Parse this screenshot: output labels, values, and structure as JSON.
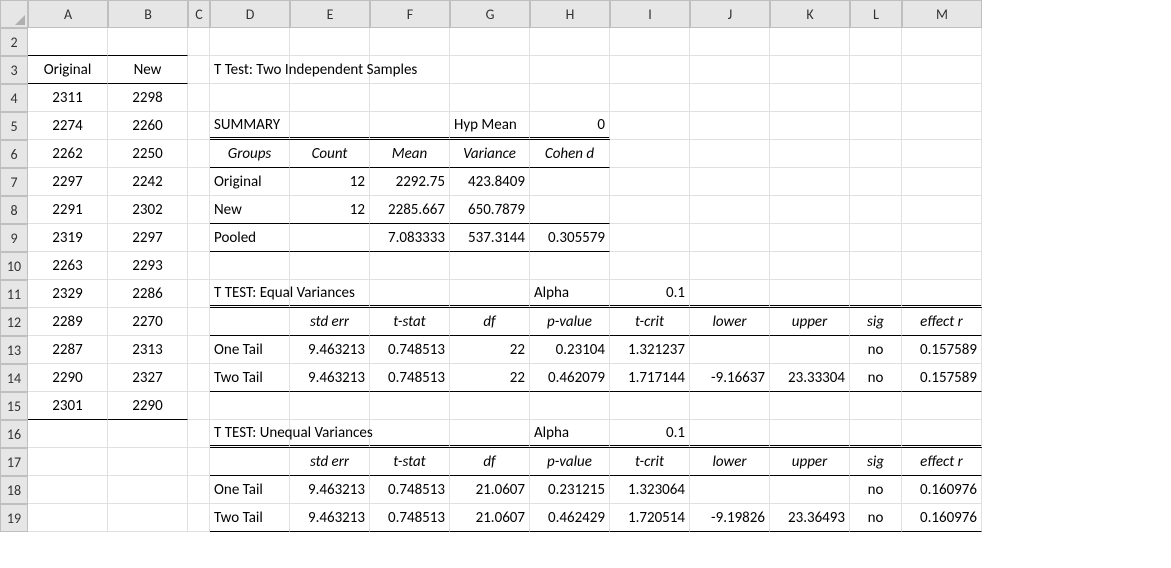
{
  "columns": [
    "A",
    "B",
    "C",
    "D",
    "E",
    "F",
    "G",
    "H",
    "I",
    "J",
    "K",
    "L",
    "M"
  ],
  "rows": [
    "2",
    "3",
    "4",
    "5",
    "6",
    "7",
    "8",
    "9",
    "10",
    "11",
    "12",
    "13",
    "14",
    "15",
    "16",
    "17",
    "18",
    "19"
  ],
  "data_headers": {
    "original": "Original",
    "new": "New"
  },
  "pairs": [
    {
      "a": "2311",
      "b": "2298"
    },
    {
      "a": "2274",
      "b": "2260"
    },
    {
      "a": "2262",
      "b": "2250"
    },
    {
      "a": "2297",
      "b": "2242"
    },
    {
      "a": "2291",
      "b": "2302"
    },
    {
      "a": "2319",
      "b": "2297"
    },
    {
      "a": "2263",
      "b": "2293"
    },
    {
      "a": "2329",
      "b": "2286"
    },
    {
      "a": "2289",
      "b": "2270"
    },
    {
      "a": "2287",
      "b": "2313"
    },
    {
      "a": "2290",
      "b": "2327"
    },
    {
      "a": "2301",
      "b": "2290"
    }
  ],
  "title": "T Test: Two Independent Samples",
  "summary": {
    "label": "SUMMARY",
    "hypmean_label": "Hyp Mean",
    "hypmean_value": "0",
    "cols": {
      "groups": "Groups",
      "count": "Count",
      "mean": "Mean",
      "variance": "Variance",
      "cohend": "Cohen d"
    },
    "rows": {
      "original": {
        "label": "Original",
        "count": "12",
        "mean": "2292.75",
        "variance": "423.8409",
        "cohend": ""
      },
      "new": {
        "label": "New",
        "count": "12",
        "mean": "2285.667",
        "variance": "650.7879",
        "cohend": ""
      },
      "pooled": {
        "label": "Pooled",
        "count": "",
        "mean": "7.083333",
        "variance": "537.3144",
        "cohend": "0.305579"
      }
    }
  },
  "eq": {
    "title": "T TEST: Equal Variances",
    "alpha_label": "Alpha",
    "alpha_value": "0.1",
    "cols": {
      "stderr": "std err",
      "tstat": "t-stat",
      "df": "df",
      "pvalue": "p-value",
      "tcrit": "t-crit",
      "lower": "lower",
      "upper": "upper",
      "sig": "sig",
      "effectr": "effect r"
    },
    "one": {
      "label": "One Tail",
      "stderr": "9.463213",
      "tstat": "0.748513",
      "df": "22",
      "pvalue": "0.23104",
      "tcrit": "1.321237",
      "lower": "",
      "upper": "",
      "sig": "no",
      "effectr": "0.157589"
    },
    "two": {
      "label": "Two Tail",
      "stderr": "9.463213",
      "tstat": "0.748513",
      "df": "22",
      "pvalue": "0.462079",
      "tcrit": "1.717144",
      "lower": "-9.16637",
      "upper": "23.33304",
      "sig": "no",
      "effectr": "0.157589"
    }
  },
  "uneq": {
    "title": "T TEST: Unequal Variances",
    "alpha_label": "Alpha",
    "alpha_value": "0.1",
    "cols": {
      "stderr": "std err",
      "tstat": "t-stat",
      "df": "df",
      "pvalue": "p-value",
      "tcrit": "t-crit",
      "lower": "lower",
      "upper": "upper",
      "sig": "sig",
      "effectr": "effect r"
    },
    "one": {
      "label": "One Tail",
      "stderr": "9.463213",
      "tstat": "0.748513",
      "df": "21.0607",
      "pvalue": "0.231215",
      "tcrit": "1.323064",
      "lower": "",
      "upper": "",
      "sig": "no",
      "effectr": "0.160976"
    },
    "two": {
      "label": "Two Tail",
      "stderr": "9.463213",
      "tstat": "0.748513",
      "df": "21.0607",
      "pvalue": "0.462429",
      "tcrit": "1.720514",
      "lower": "-9.19826",
      "upper": "23.36493",
      "sig": "no",
      "effectr": "0.160976"
    }
  }
}
